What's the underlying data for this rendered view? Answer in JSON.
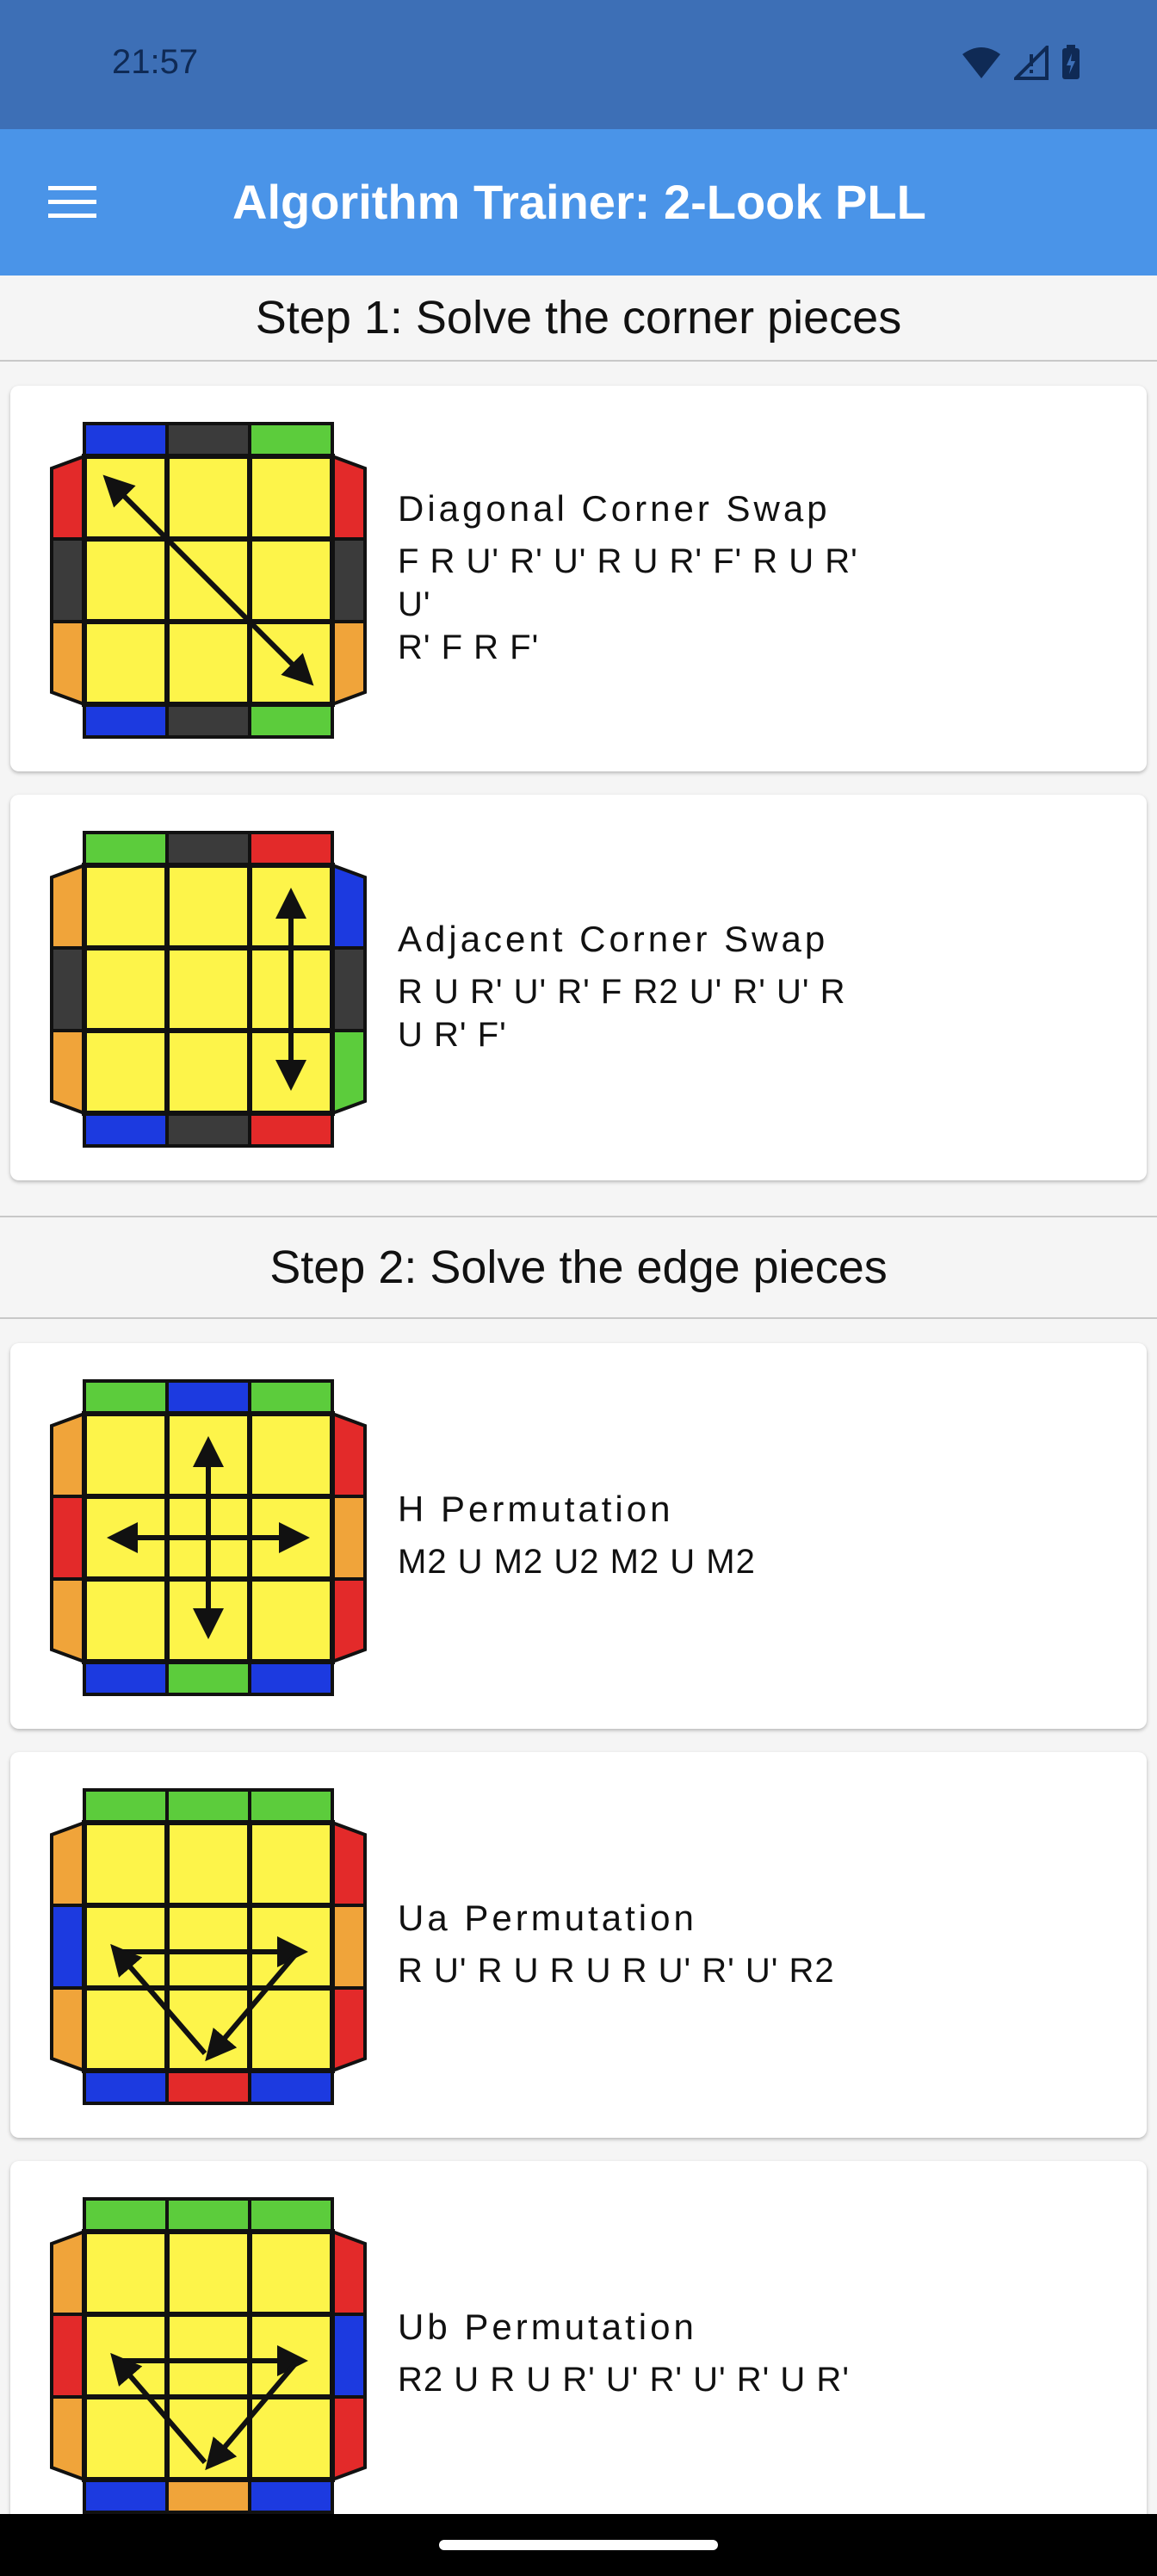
{
  "status_bar": {
    "time": "21:57"
  },
  "app_bar": {
    "title": "Algorithm Trainer: 2-Look PLL"
  },
  "sections": [
    {
      "title": "Step 1: Solve the corner pieces"
    },
    {
      "title": "Step 2: Solve the edge pieces"
    }
  ],
  "algorithms": [
    {
      "name": "Diagonal Corner Swap",
      "moves_line1": "F R U' R' U' R U R' F' R U R' U'",
      "moves_line2": "R' F R F'",
      "top_colors": [
        "blue",
        "gray",
        "green"
      ],
      "bottom_colors": [
        "blue",
        "gray",
        "green"
      ],
      "left_colors": [
        "red",
        "gray",
        "orange"
      ],
      "right_colors": [
        "red",
        "gray",
        "orange"
      ],
      "arrow": "diagonal"
    },
    {
      "name": "Adjacent Corner Swap",
      "moves_line1": "R U R' U' R' F R2 U' R' U' R U R' F'",
      "moves_line2": "",
      "top_colors": [
        "green",
        "gray",
        "red"
      ],
      "bottom_colors": [
        "blue",
        "gray",
        "red"
      ],
      "left_colors": [
        "orange",
        "gray",
        "orange"
      ],
      "right_colors": [
        "blue",
        "gray",
        "green"
      ],
      "arrow": "vertical-right"
    },
    {
      "name": "H Permutation",
      "moves_line1": "M2 U M2 U2 M2 U M2",
      "moves_line2": "",
      "top_colors": [
        "green",
        "blue",
        "green"
      ],
      "bottom_colors": [
        "blue",
        "green",
        "blue"
      ],
      "left_colors": [
        "orange",
        "red",
        "orange"
      ],
      "right_colors": [
        "red",
        "orange",
        "red"
      ],
      "arrow": "cross"
    },
    {
      "name": "Ua Permutation",
      "moves_line1": "R U' R U R U R U' R' U' R2",
      "moves_line2": "",
      "top_colors": [
        "green",
        "green",
        "green"
      ],
      "bottom_colors": [
        "blue",
        "red",
        "blue"
      ],
      "left_colors": [
        "orange",
        "blue",
        "orange"
      ],
      "right_colors": [
        "red",
        "orange",
        "red"
      ],
      "arrow": "triangle"
    },
    {
      "name": "Ub Permutation",
      "moves_line1": "R2 U R U R' U' R' U' R' U R'",
      "moves_line2": "",
      "top_colors": [
        "green",
        "green",
        "green"
      ],
      "bottom_colors": [
        "blue",
        "orange",
        "blue"
      ],
      "left_colors": [
        "orange",
        "red",
        "orange"
      ],
      "right_colors": [
        "red",
        "blue",
        "red"
      ],
      "arrow": "triangle"
    }
  ],
  "colors": {
    "yellow": "#fdf44a",
    "blue": "#1c3ae0",
    "green": "#5ccc3c",
    "red": "#e32a2a",
    "orange": "#f0a43a",
    "gray": "#3b3b3b"
  }
}
